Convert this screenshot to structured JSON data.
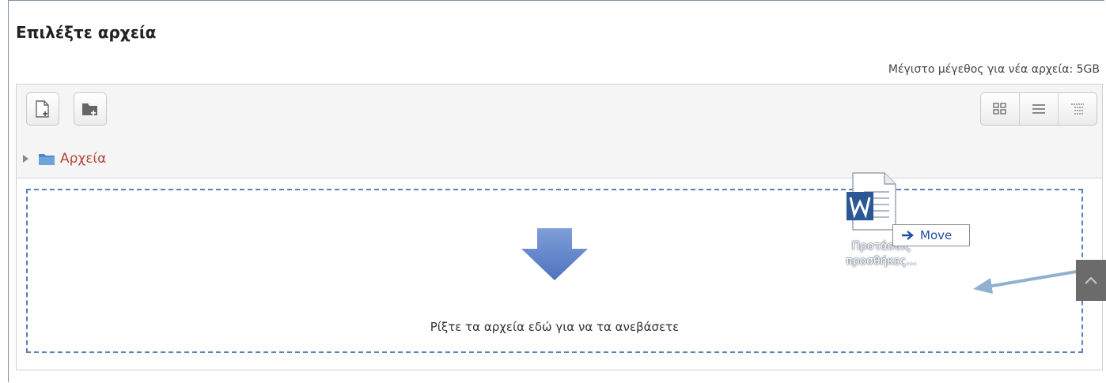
{
  "panel": {
    "title": "Επιλέξτε αρχεία",
    "max_size_label": "Μέγιστο μέγεθος για νέα αρχεία: 5GB"
  },
  "toolbar": {
    "left_buttons": [
      {
        "name": "add-file-button",
        "icon": "add-file-icon"
      },
      {
        "name": "create-folder-button",
        "icon": "create-folder-icon"
      }
    ],
    "view_buttons": [
      {
        "name": "view-icons-button",
        "icon": "grid-icon"
      },
      {
        "name": "view-list-button",
        "icon": "list-icon"
      },
      {
        "name": "view-tree-button",
        "icon": "tree-icon"
      }
    ]
  },
  "path": {
    "folder_label": "Αρχεία",
    "icon": "folder-icon"
  },
  "dropzone": {
    "text": "Ρίξτε τα αρχεία εδώ για να τα ανεβάσετε",
    "icon": "down-arrow-icon"
  },
  "drag": {
    "file_name": "Προτάσεις προσθήκες...",
    "file_icon": "word-document-icon",
    "badge_label": "Move"
  },
  "colors": {
    "accent": "#5b7fb9",
    "path_link": "#b5463c",
    "move_text": "#1f4ea1",
    "pointer": "#8fb0cf"
  }
}
